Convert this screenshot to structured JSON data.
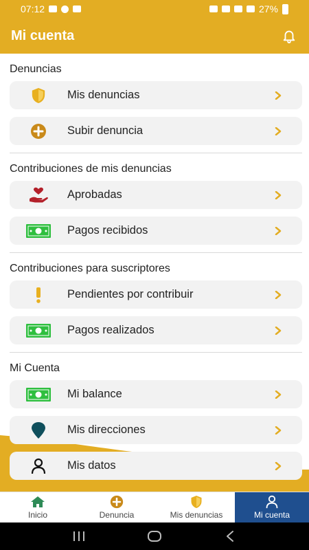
{
  "status_bar": {
    "time": "07:12",
    "battery": "27%"
  },
  "header": {
    "title": "Mi cuenta"
  },
  "sections": [
    {
      "title": "Denuncias",
      "items": [
        {
          "label": "Mis denuncias",
          "icon": "shield-icon"
        },
        {
          "label": "Subir denuncia",
          "icon": "plus-circle-icon"
        }
      ]
    },
    {
      "title": "Contribuciones de mis denuncias",
      "items": [
        {
          "label": "Aprobadas",
          "icon": "hand-heart-icon"
        },
        {
          "label": "Pagos recibidos",
          "icon": "cash-icon"
        }
      ]
    },
    {
      "title": "Contribuciones para suscriptores",
      "items": [
        {
          "label": "Pendientes por contribuir",
          "icon": "exclamation-icon"
        },
        {
          "label": "Pagos realizados",
          "icon": "cash-icon"
        }
      ]
    },
    {
      "title": "Mi Cuenta",
      "items": [
        {
          "label": "Mi balance",
          "icon": "cash-icon"
        },
        {
          "label": "Mis direcciones",
          "icon": "map-pin-icon"
        },
        {
          "label": "Mis datos",
          "icon": "user-icon"
        }
      ]
    }
  ],
  "bottom_nav": [
    {
      "label": "Inicio",
      "icon": "home-icon",
      "active": false
    },
    {
      "label": "Denuncia",
      "icon": "plus-circle-icon",
      "active": false
    },
    {
      "label": "Mis denuncias",
      "icon": "shield-icon",
      "active": false
    },
    {
      "label": "Mi cuenta",
      "icon": "user-icon",
      "active": true
    }
  ],
  "colors": {
    "brand": "#e3ad23",
    "active_nav": "#1f4f8f",
    "cash_green": "#2fbf3f",
    "heart_red": "#b3202a",
    "pin_teal": "#0f4f5c",
    "shield_gold": "#e8b020",
    "plus_brown": "#c98a1a"
  }
}
